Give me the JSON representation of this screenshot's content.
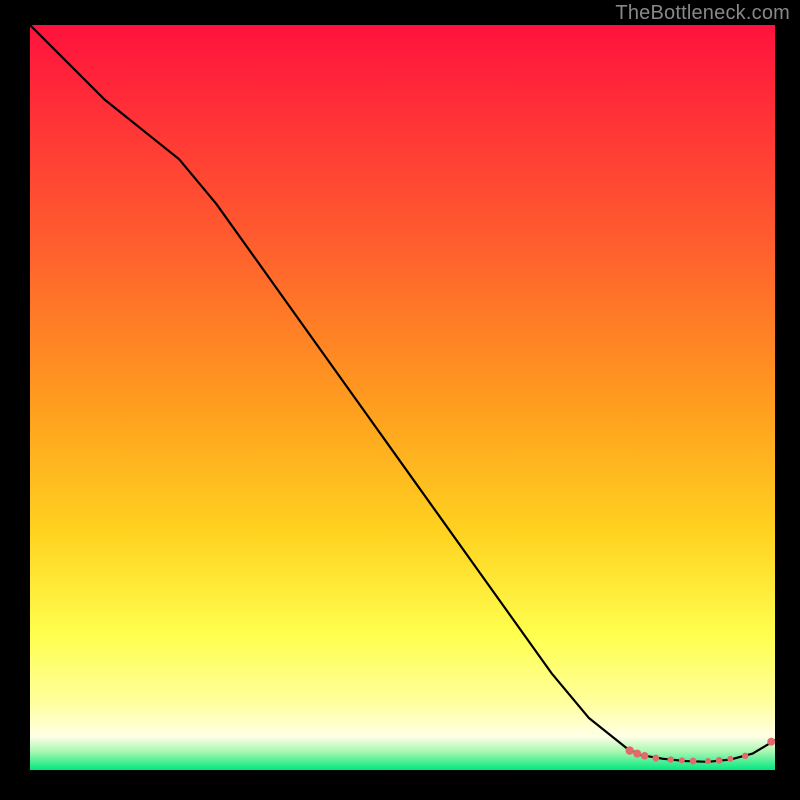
{
  "watermark": "TheBottleneck.com",
  "colors": {
    "page_bg": "#000000",
    "gradient_top": "#ff123d",
    "gradient_mid1": "#ff7a2a",
    "gradient_mid2": "#ffd21f",
    "gradient_mid3": "#ffff55",
    "gradient_pale": "#ffffa9",
    "gradient_green": "#00e87e",
    "line": "#000000",
    "marker": "#e26a6a"
  },
  "chart_data": {
    "type": "line",
    "title": "",
    "xlabel": "",
    "ylabel": "",
    "xlim": [
      0,
      100
    ],
    "ylim": [
      0,
      100
    ],
    "series": [
      {
        "name": "main-curve",
        "x": [
          0,
          5,
          10,
          15,
          20,
          25,
          30,
          35,
          40,
          45,
          50,
          55,
          60,
          65,
          70,
          75,
          80,
          82,
          85,
          88,
          91,
          94,
          97,
          100
        ],
        "y": [
          100,
          95,
          90,
          86,
          82,
          76,
          69,
          62,
          55,
          48,
          41,
          34,
          27,
          20,
          13,
          7,
          3,
          2,
          1.5,
          1.2,
          1.1,
          1.4,
          2.2,
          4
        ]
      }
    ],
    "markers": [
      {
        "x": 80.5,
        "y": 2.6,
        "r": 4.2
      },
      {
        "x": 81.5,
        "y": 2.2,
        "r": 4.0
      },
      {
        "x": 82.5,
        "y": 1.9,
        "r": 3.8
      },
      {
        "x": 84.0,
        "y": 1.6,
        "r": 3.4
      },
      {
        "x": 86.0,
        "y": 1.4,
        "r": 3.2
      },
      {
        "x": 87.5,
        "y": 1.3,
        "r": 3.0
      },
      {
        "x": 89.0,
        "y": 1.2,
        "r": 3.4
      },
      {
        "x": 91.0,
        "y": 1.2,
        "r": 3.0
      },
      {
        "x": 92.5,
        "y": 1.3,
        "r": 3.4
      },
      {
        "x": 94.0,
        "y": 1.5,
        "r": 3.0
      },
      {
        "x": 96.0,
        "y": 1.9,
        "r": 3.2
      },
      {
        "x": 99.5,
        "y": 3.8,
        "r": 4.0
      }
    ],
    "gradient_stops": [
      {
        "offset": 0.0,
        "color": "#ff123d"
      },
      {
        "offset": 0.28,
        "color": "#ff5a2f"
      },
      {
        "offset": 0.5,
        "color": "#ff9a1f"
      },
      {
        "offset": 0.68,
        "color": "#ffd21f"
      },
      {
        "offset": 0.82,
        "color": "#ffff4f"
      },
      {
        "offset": 0.91,
        "color": "#ffff9e"
      },
      {
        "offset": 0.955,
        "color": "#ffffe6"
      },
      {
        "offset": 0.975,
        "color": "#aaf7b2"
      },
      {
        "offset": 1.0,
        "color": "#00e87e"
      }
    ]
  }
}
